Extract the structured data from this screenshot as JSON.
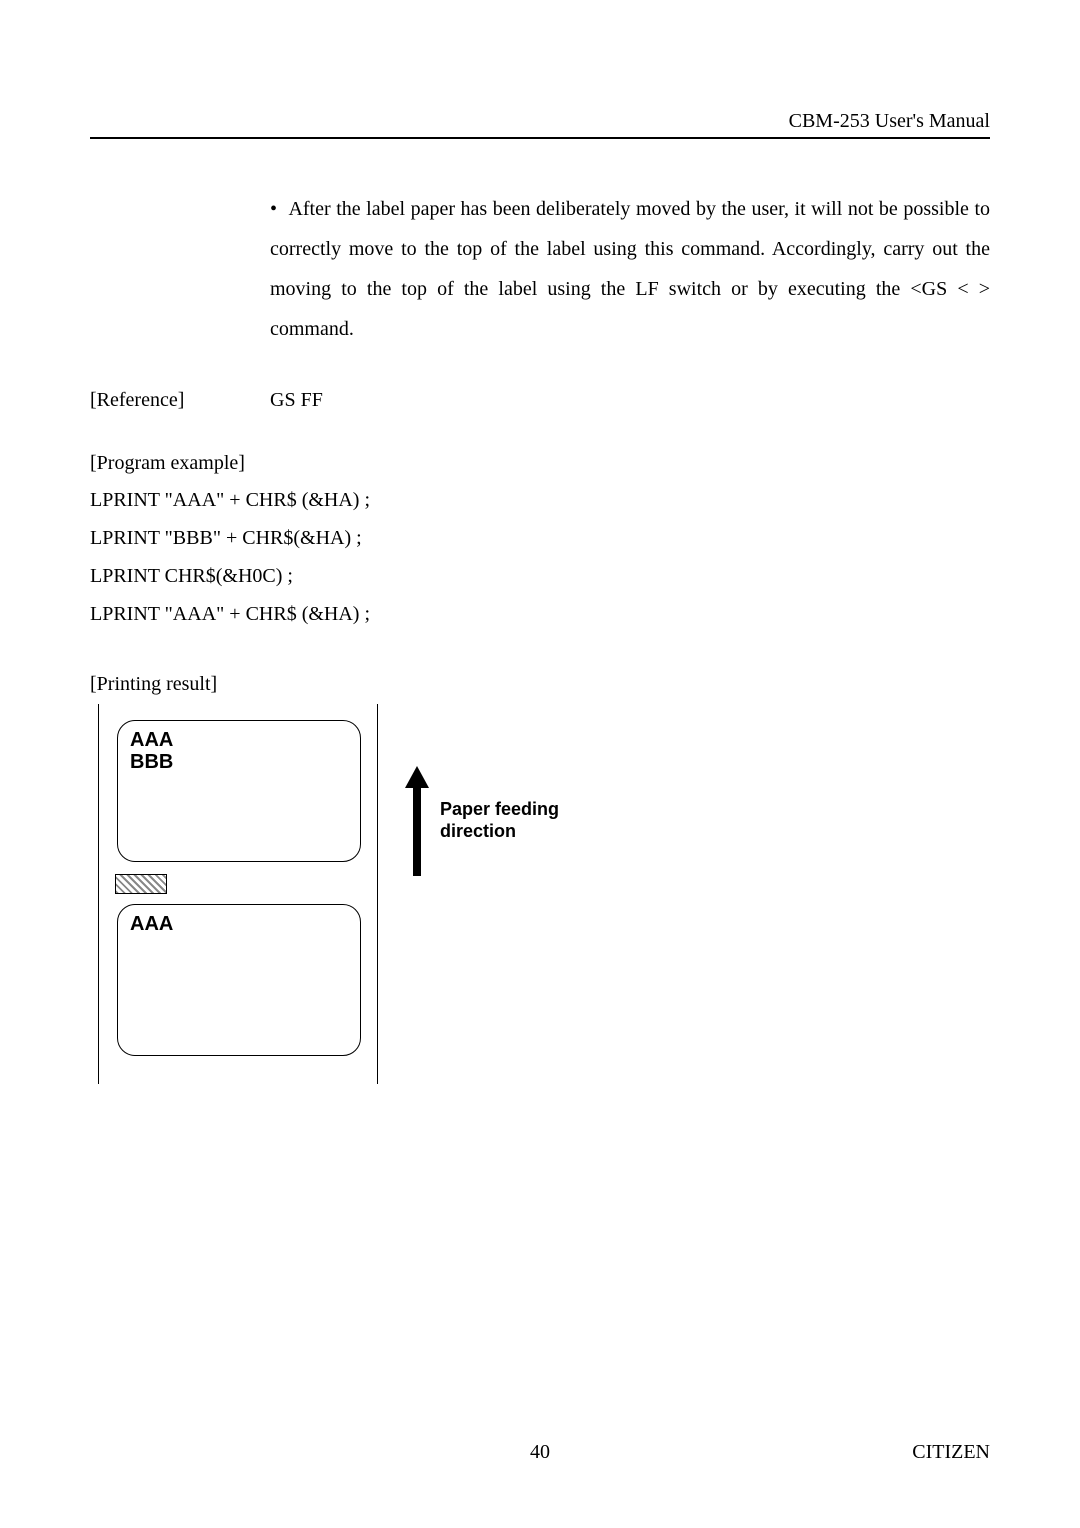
{
  "header": {
    "title": "CBM-253 User's Manual"
  },
  "body": {
    "bullet_text": "After the label paper has been deliberately moved by the user, it will not be possible to correctly move to the top of the label using this command. Accordingly, carry out the moving to the top of the label using the LF switch or by executing the <GS < > command."
  },
  "reference": {
    "label": "[Reference]",
    "value": "GS FF"
  },
  "program_example": {
    "label": "[Program example]",
    "lines": [
      "LPRINT \"AAA\" + CHR$ (&HA) ;",
      "LPRINT \"BBB\" + CHR$(&HA) ;",
      "LPRINT CHR$(&H0C) ;",
      "LPRINT \"AAA\" + CHR$ (&HA) ;"
    ]
  },
  "printing_result": {
    "label": "[Printing result]",
    "label1_line1": "AAA",
    "label1_line2": "BBB",
    "label2_line1": "AAA",
    "arrow_label_line1": "Paper feeding",
    "arrow_label_line2": "direction"
  },
  "footer": {
    "page_number": "40",
    "brand": "CITIZEN"
  }
}
